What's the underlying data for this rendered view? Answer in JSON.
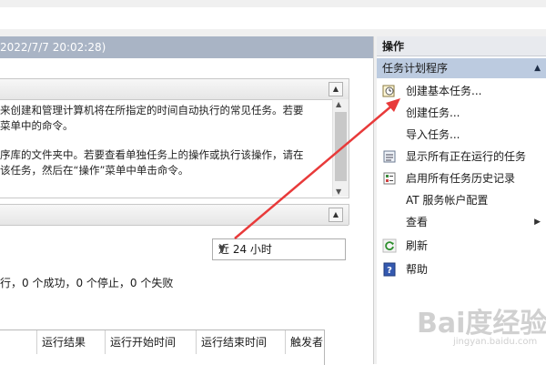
{
  "header": {
    "date_text": "2022/7/7 20:02:28)"
  },
  "overview": {
    "line1": "来创建和管理计算机将在所指定的时间自动执行的常见任务。若要",
    "line2": "菜单中的命令。",
    "line3": "序库的文件夹中。若要查看单独任务上的操作或执行该操作，请在",
    "line4": "该任务，然后在“操作”菜单中单击命令。"
  },
  "status": {
    "time_filter": "近 24 小时",
    "summary": "行，0 个成功，0 个停止，0 个失败",
    "columns": [
      "运行结果",
      "运行开始时间",
      "运行结束时间",
      "触发者"
    ]
  },
  "actions": {
    "title": "操作",
    "section": "任务计划程序",
    "items": [
      {
        "label": "创建基本任务...",
        "icon": "create-basic-task-icon"
      },
      {
        "label": "创建任务...",
        "icon": "none"
      },
      {
        "label": "导入任务...",
        "icon": "none"
      },
      {
        "label": "显示所有正在运行的任务",
        "icon": "running-tasks-icon"
      },
      {
        "label": "启用所有任务历史记录",
        "icon": "history-icon"
      },
      {
        "label": "AT 服务帐户配置",
        "icon": "none"
      },
      {
        "label": "查看",
        "icon": "none"
      },
      {
        "label": "刷新",
        "icon": "refresh-icon"
      },
      {
        "label": "帮助",
        "icon": "help-icon"
      }
    ]
  },
  "watermark": {
    "text": "Bai度经验",
    "url": "jingyan.baidu.com"
  },
  "colors": {
    "annotation_arrow": "#e83a3a",
    "section_header": "#bccbe0",
    "date_header": "#a9b4c5"
  }
}
